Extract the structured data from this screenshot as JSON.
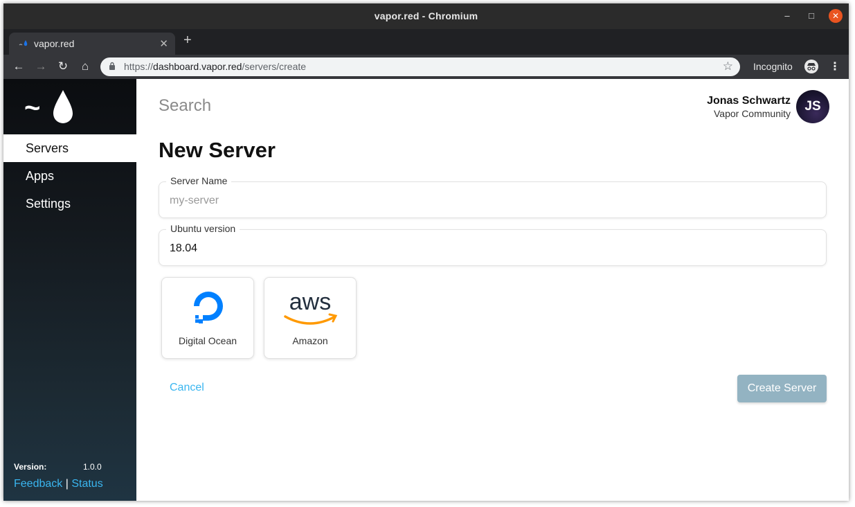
{
  "window": {
    "title": "vapor.red - Chromium"
  },
  "browser": {
    "tab_title": "vapor.red",
    "url_prefix": "https://",
    "url_host": "dashboard.vapor.red",
    "url_path": "/servers/create",
    "incognito_label": "Incognito"
  },
  "sidebar": {
    "logo_tilde": "~",
    "items": [
      {
        "label": "Servers",
        "active": true
      },
      {
        "label": "Apps",
        "active": false
      },
      {
        "label": "Settings",
        "active": false
      }
    ],
    "version_label": "Version:",
    "version_value": "1.0.0",
    "feedback_label": "Feedback",
    "separator": "|",
    "status_label": "Status"
  },
  "header": {
    "search_placeholder": "Search",
    "user_name": "Jonas Schwartz",
    "user_org": "Vapor Community",
    "avatar_initials": "JS"
  },
  "form": {
    "title": "New Server",
    "server_name_label": "Server Name",
    "server_name_placeholder": "my-server",
    "ubuntu_label": "Ubuntu version",
    "ubuntu_value": "18.04",
    "providers": [
      {
        "label": "Digital Ocean",
        "icon": "digitalocean-icon"
      },
      {
        "label": "Amazon",
        "icon": "aws-icon"
      }
    ],
    "cancel_label": "Cancel",
    "create_label": "Create Server"
  },
  "colors": {
    "accent": "#3ab6f0",
    "create_button": "#93b3c2",
    "close_button": "#e95420",
    "digitalocean": "#0080ff",
    "aws_smile": "#ff9900"
  }
}
